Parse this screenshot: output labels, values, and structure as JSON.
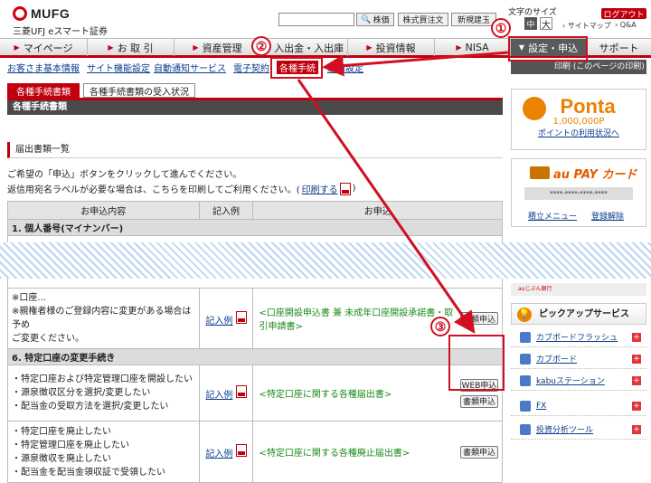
{
  "header": {
    "brand": "MUFG",
    "brand_sub": "三菱UFJ eスマート証券",
    "search_button": "株価",
    "buttons": [
      "株式買注文",
      "新規建玉"
    ],
    "text_size_label": "文字のサイズ",
    "text_size_mid": "中",
    "text_size_big": "大",
    "logout": "ログアウト",
    "sitemap": "サイトマップ",
    "qa": "Q&A"
  },
  "nav": {
    "items": [
      "マイページ",
      "お 取 引",
      "資産管理",
      "入出金・入出庫",
      "投資情報",
      "NISA",
      "設定・申込",
      "サポート"
    ]
  },
  "subnav": {
    "items": [
      "お客さま基本情報",
      "サイト機能設定",
      "自動通知サービス",
      "電子契約",
      "各種手続",
      "通知設定"
    ]
  },
  "tabs": [
    "各種手続書類",
    "各種手続書類の受入状況"
  ],
  "section_title": "各種手続書類",
  "list_heading": "届出書類一覧",
  "instructions": {
    "line1": "ご希望の「申込」ボタンをクリックして進んでください。",
    "line2_prefix": "返信用宛名ラベルが必要な場合は、こちらを印刷してご利用ください。(",
    "line2_link": "印刷する",
    "line2_suffix": ")"
  },
  "table": {
    "headers": [
      "お申込内容",
      "記入例",
      "お申込"
    ],
    "cat1": "1. 個人番号(マイナンバー)",
    "partial_row": {
      "left_lines": [
        "※口座...",
        "※親権者様のご登録内容に変更がある場合は予め",
        "ご変更ください。"
      ],
      "example": "記入例",
      "form": "<口座開設申込書 兼 未成年口座開設承諾書・取引申請書>",
      "button": "書類申込"
    },
    "cat6": "6. 特定口座の変更手続き",
    "row1": {
      "left_lines": [
        "・特定口座および特定管理口座を開設したい",
        "・源泉徴収区分を選択/変更したい",
        "・配当金の受取方法を選択/変更したい"
      ],
      "example": "記入例",
      "form": "<特定口座に関する各種届出書>",
      "buttons": [
        "WEB申込",
        "書類申込"
      ]
    },
    "row2": {
      "left_lines": [
        "・特定口座を廃止したい",
        "・特定管理口座を廃止したい",
        "・源泉徴収を廃止したい",
        "・配当金を配当金領収証で受領したい"
      ],
      "example": "記入例",
      "form": "<特定口座に関する各種廃止届出書>",
      "button": "書類申込"
    }
  },
  "right_panel": {
    "print_label": "印刷 (このページの印刷)",
    "ponta_title": "Ponta",
    "ponta_points": "1,000,000P",
    "ponta_link": "ポイントの利用状況へ",
    "aupay_title": "au PAY カード",
    "aupay_card": "****-****-****-****",
    "aupay_links": [
      "積立メニュー",
      "登録解除"
    ],
    "strip_text": "auじぶん銀行",
    "pickup_title": "ピックアップサービス",
    "services": [
      "カブボードフラッシュ",
      "カブボード",
      "kabuステーション",
      "FX",
      "投資分析ツール"
    ]
  },
  "annotations": {
    "badges": [
      "①",
      "②",
      "③"
    ]
  },
  "colors": {
    "brand_red": "#c0000d",
    "annotation_red": "#d01020",
    "link_blue": "#0b3c8c",
    "form_green": "#1a8a1a",
    "ponta_orange": "#e98300"
  }
}
